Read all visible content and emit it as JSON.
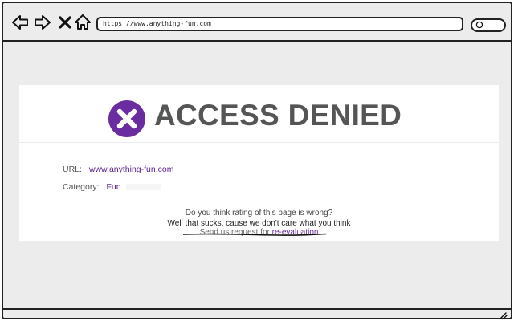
{
  "toolbar": {
    "back_icon": "arrow-left-icon",
    "forward_icon": "arrow-right-icon",
    "close_icon": "x-icon",
    "home_icon": "home-icon",
    "url": "https://www.anything-fun.com",
    "search_icon": "search-icon"
  },
  "page": {
    "title": "ACCESS DENIED",
    "status_icon": "x-circle-icon",
    "url_label": "URL:",
    "url_value": "www.anything-fun.com",
    "category_label": "Category:",
    "category_value": "Fun",
    "question": "Do you think rating of this page is wrong?",
    "remark": "Well that sucks, cause we don't care what you think",
    "request_text": "Send us request for ",
    "request_link": "re-evaluation"
  },
  "colors": {
    "accent": "#6a2da0",
    "title": "#555555",
    "background": "#ececec"
  }
}
